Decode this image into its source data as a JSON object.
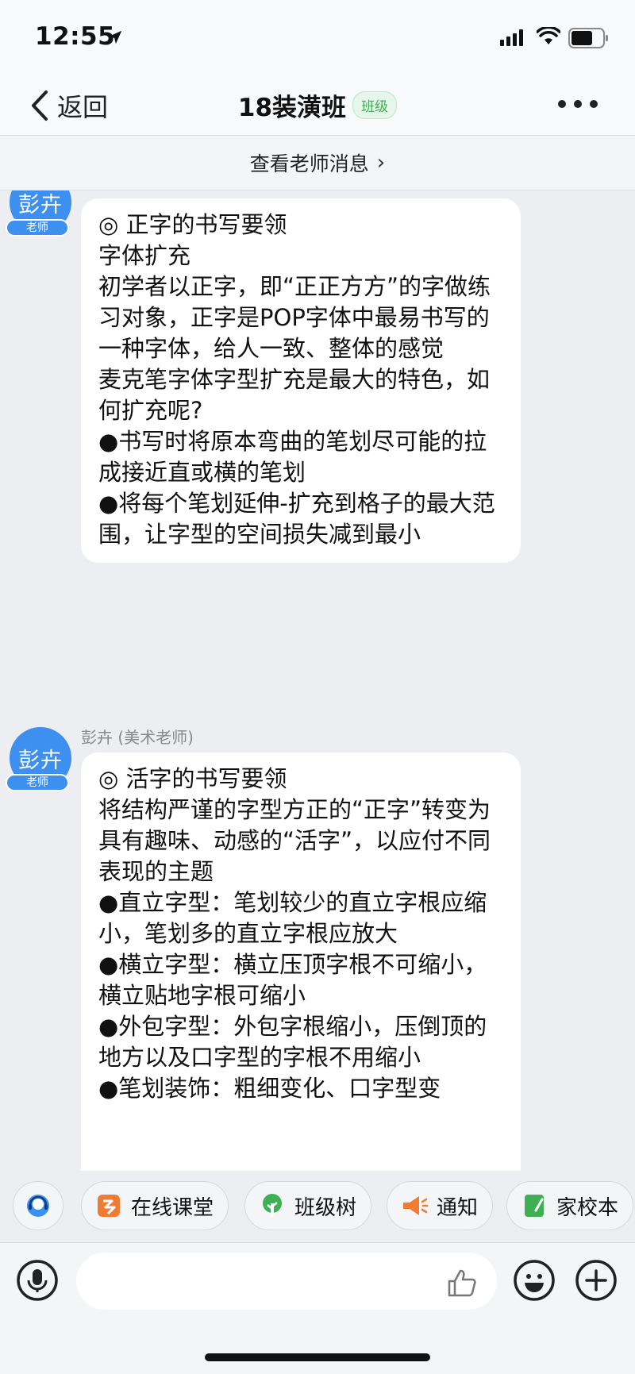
{
  "status_bar": {
    "time": "12:55"
  },
  "nav": {
    "back_label": "返回",
    "title": "18装潢班",
    "badge": "班级"
  },
  "teacher_bar": {
    "label": "查看老师消息",
    "chevron": "›"
  },
  "messages": [
    {
      "avatar_text": "彭卉",
      "role_tag": "老师",
      "sender": "",
      "lines": [
        "◎ 正字的书写要领",
        "字体扩充",
        "初学者以正字，即“正正方方”的字做练习对象，正字是POP字体中最易书写的一种字体，给人一致、整体的感觉",
        "麦克笔字体字型扩充是最大的特色，如何扩充呢?",
        "●书写时将原本弯曲的笔划尽可能的拉成接近直或横的笔划",
        "●将每个笔划延伸-扩充到格子的最大范围，让字型的空间损失减到最小"
      ]
    },
    {
      "avatar_text": "彭卉",
      "role_tag": "老师",
      "sender": "彭卉 (美术老师)",
      "lines": [
        "◎ 活字的书写要领",
        "将结构严谨的字型方正的“正字”转变为具有趣味、动感的“活字”，以应付不同表现的主题",
        "●直立字型：笔划较少的直立字根应缩小，笔划多的直立字根应放大",
        "●横立字型：横立压顶字根不可缩小，横立贴地字根可缩小",
        "●外包字型：外包字根缩小，压倒顶的地方以及口字型的字根不用缩小",
        "●笔划装饰：粗细变化、口字型变"
      ]
    }
  ],
  "quick_actions": [
    {
      "label": "",
      "icon": "customer-service-icon"
    },
    {
      "label": "在线课堂",
      "icon": "online-class-icon"
    },
    {
      "label": "班级树",
      "icon": "tree-icon"
    },
    {
      "label": "通知",
      "icon": "megaphone-icon"
    },
    {
      "label": "家校本",
      "icon": "notebook-icon"
    }
  ],
  "input_bar": {
    "placeholder": ""
  },
  "colors": {
    "accent_blue": "#3d8ff0",
    "badge_green": "#3eaf52",
    "background": "#eceef1"
  }
}
